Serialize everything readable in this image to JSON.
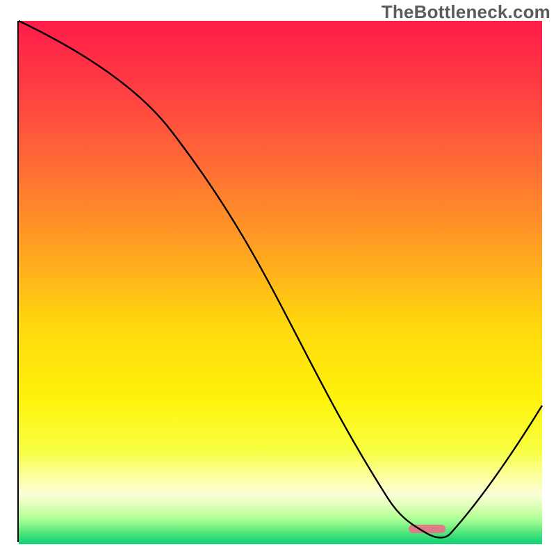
{
  "watermark": "TheBottleneck.com",
  "chart_data": {
    "type": "line",
    "title": "",
    "xlabel": "",
    "ylabel": "",
    "xlim": [
      0,
      100
    ],
    "ylim": [
      0,
      100
    ],
    "grid": false,
    "legend": false,
    "background": {
      "stops": [
        {
          "pos": 0.0,
          "color": "#ff1b49"
        },
        {
          "pos": 0.12,
          "color": "#ff3b44"
        },
        {
          "pos": 0.28,
          "color": "#ff6d35"
        },
        {
          "pos": 0.44,
          "color": "#ffa321"
        },
        {
          "pos": 0.58,
          "color": "#ffd80e"
        },
        {
          "pos": 0.72,
          "color": "#fff20a"
        },
        {
          "pos": 0.82,
          "color": "#f8ff40"
        },
        {
          "pos": 0.885,
          "color": "#fcffb8"
        },
        {
          "pos": 0.905,
          "color": "#f8ffd8"
        },
        {
          "pos": 0.918,
          "color": "#eaffc6"
        },
        {
          "pos": 0.932,
          "color": "#d4ffb0"
        },
        {
          "pos": 0.948,
          "color": "#b6ff9a"
        },
        {
          "pos": 0.962,
          "color": "#8df88a"
        },
        {
          "pos": 0.975,
          "color": "#5be97e"
        },
        {
          "pos": 0.988,
          "color": "#2fdc78"
        },
        {
          "pos": 1.0,
          "color": "#10d172"
        }
      ]
    },
    "series": [
      {
        "name": "bottleneck-curve",
        "color": "#000000",
        "x": [
          0,
          29,
          70.5,
          78,
          82.5,
          100
        ],
        "values": [
          100,
          79,
          8.2,
          1.4,
          1.4,
          26
        ]
      }
    ],
    "marker": {
      "name": "optimal-range",
      "color": "#df7b86",
      "x_center": 78,
      "y": 2.3,
      "width_pct": 7,
      "height_pct": 1.6
    }
  }
}
